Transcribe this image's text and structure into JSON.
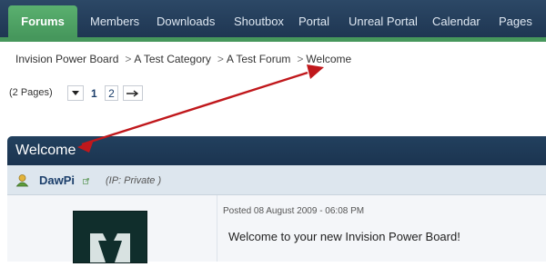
{
  "nav": {
    "active": "Forums",
    "items": [
      "Members",
      "Downloads",
      "Shoutbox",
      "Portal",
      "Unreal Portal",
      "Calendar",
      "Pages"
    ]
  },
  "breadcrumb": {
    "items": [
      "Invision Power Board",
      "A Test Category",
      "A Test Forum",
      "Welcome"
    ]
  },
  "pagination": {
    "label": "(2 Pages)",
    "current": "1",
    "next_page": "2"
  },
  "topic": {
    "title": "Welcome"
  },
  "post": {
    "author": "DawPi",
    "ip": "(IP: Private )",
    "date": "Posted 08 August 2009 - 06:08 PM",
    "body": "Welcome to your new Invision Power Board!"
  },
  "colors": {
    "nav_bg": "#1d3450",
    "active_tab": "#46975c",
    "annotation_arrow": "#c0181c"
  }
}
